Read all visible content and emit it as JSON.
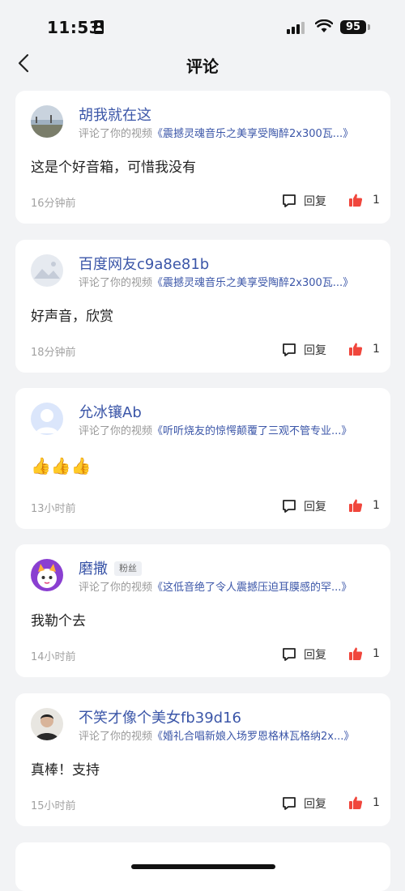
{
  "status": {
    "time": "11:53",
    "battery": "95"
  },
  "nav": {
    "title": "评论"
  },
  "comments": [
    {
      "user": "胡我就在这",
      "sub_label": "评论了你的视频",
      "video_title": "《震撼灵魂音乐之美享受陶醉2x300瓦...》",
      "text": "这是个好音箱，可惜我没有",
      "time": "16分钟前",
      "reply_label": "回复",
      "likes": "1",
      "avatar_icon": "landscape-avatar"
    },
    {
      "user": "百度网友c9a8e81b",
      "sub_label": "评论了你的视频",
      "video_title": "《震撼灵魂音乐之美享受陶醉2x300瓦...》",
      "text": "好声音，欣赏",
      "time": "18分钟前",
      "reply_label": "回复",
      "likes": "1",
      "avatar_icon": "default-landscape-avatar"
    },
    {
      "user": "允冰镶Ab",
      "sub_label": "评论了你的视频",
      "video_title": "《听听烧友的惊愕颠覆了三观不管专业...》",
      "text": "👍👍👍",
      "time": "13小时前",
      "reply_label": "回复",
      "likes": "1",
      "avatar_icon": "default-person-avatar"
    },
    {
      "user": "磨撒",
      "badge": "粉丝",
      "sub_label": "评论了你的视频",
      "video_title": "《这低音绝了令人震撼压迫耳膜感的罕...》",
      "text": "我勒个去",
      "time": "14小时前",
      "reply_label": "回复",
      "likes": "1",
      "avatar_icon": "cartoon-cat-avatar"
    },
    {
      "user": "不笑才像个美女fb39d16",
      "sub_label": "评论了你的视频",
      "video_title": "《婚礼合唱新娘入场罗恩格林瓦格纳2x...》",
      "text": "真棒！支持",
      "time": "15小时前",
      "reply_label": "回复",
      "likes": "1",
      "avatar_icon": "person-photo-avatar"
    }
  ],
  "colors": {
    "accent": "#3b56a8",
    "like": "#f0463c",
    "background": "#f2f3f5"
  }
}
